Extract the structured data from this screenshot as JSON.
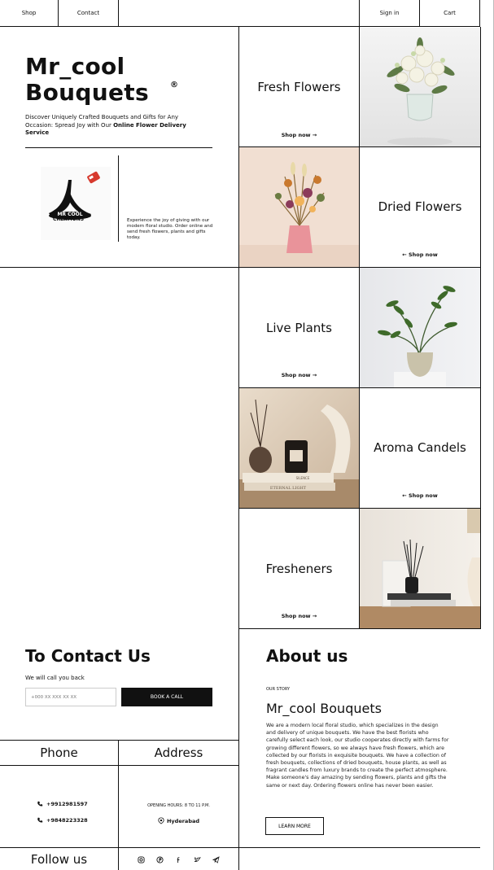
{
  "nav": {
    "shop": "Shop",
    "contact": "Contact",
    "signin": "Sign in",
    "cart": "Cart"
  },
  "hero": {
    "title_line1": "Mr_cool",
    "title_line2": "Bouquets",
    "registered": "®",
    "desc_plain": "Discover Uniquely Crafted Bouquets and Gifts for Any Occasion: Spread Joy with Our ",
    "desc_bold": "Online Flower Delivery Service",
    "logo_text_1": "MR COOL",
    "logo_text_2": "CREATIONS",
    "blurb": "Experience the joy of giving with our modern floral studio. Order online and send fresh flowers, plants and gifts today."
  },
  "categories": [
    {
      "title": "Fresh Flowers",
      "shop": "Shop now →"
    },
    {
      "title": "Dried Flowers",
      "shop": "← Shop now"
    },
    {
      "title": "Live Plants",
      "shop": "Shop now →"
    },
    {
      "title": "Aroma Candels",
      "shop": "← Shop now"
    },
    {
      "title": "Fresheners",
      "shop": "Shop now →"
    }
  ],
  "candle_book_text_1": "SILENCE",
  "candle_book_text_2": "ETERNAL LIGHT",
  "contact": {
    "title": "To Contact Us",
    "subtitle": "We will call you back",
    "phone_placeholder": "+000 XX XXX XX XX",
    "book_label": "BOOK A CALL",
    "phone_heading": "Phone",
    "address_heading": "Address",
    "phone1": "+9912981597",
    "phone2": "+9848223328",
    "hours": "OPENING HOURS: 8 TO 11 P.M.",
    "city": "Hyderabad",
    "follow": "Follow us"
  },
  "about": {
    "title": "About us",
    "eyebrow": "OUR STORY",
    "heading": "Mr_cool Bouquets",
    "body": "We are a modern local floral studio, which specializes in the design and delivery of unique bouquets. We have the best florists who carefully select each look, our studio cooperates directly with farms for growing different flowers, so we always have fresh flowers, which are collected by our florists in exquisite bouquets. We have a collection of fresh bouquets, collections of dried bouquets, house plants, as well as fragrant candles from luxury brands to create the perfect atmosphere. Make someone's day amazing by sending flowers, plants and gifts the same or next day. Ordering flowers online has never been easier.",
    "learn_more": "LEARN MORE"
  },
  "icons": [
    "phone-icon",
    "location-pin-icon",
    "instagram-icon",
    "pinterest-icon",
    "facebook-icon",
    "twitter-icon",
    "telegram-icon"
  ],
  "colors": {
    "ink": "#111111",
    "pink_vase": "#e9939a",
    "photo_grey": "#e8e8e8",
    "peach_bg": "#f1dfd2"
  }
}
